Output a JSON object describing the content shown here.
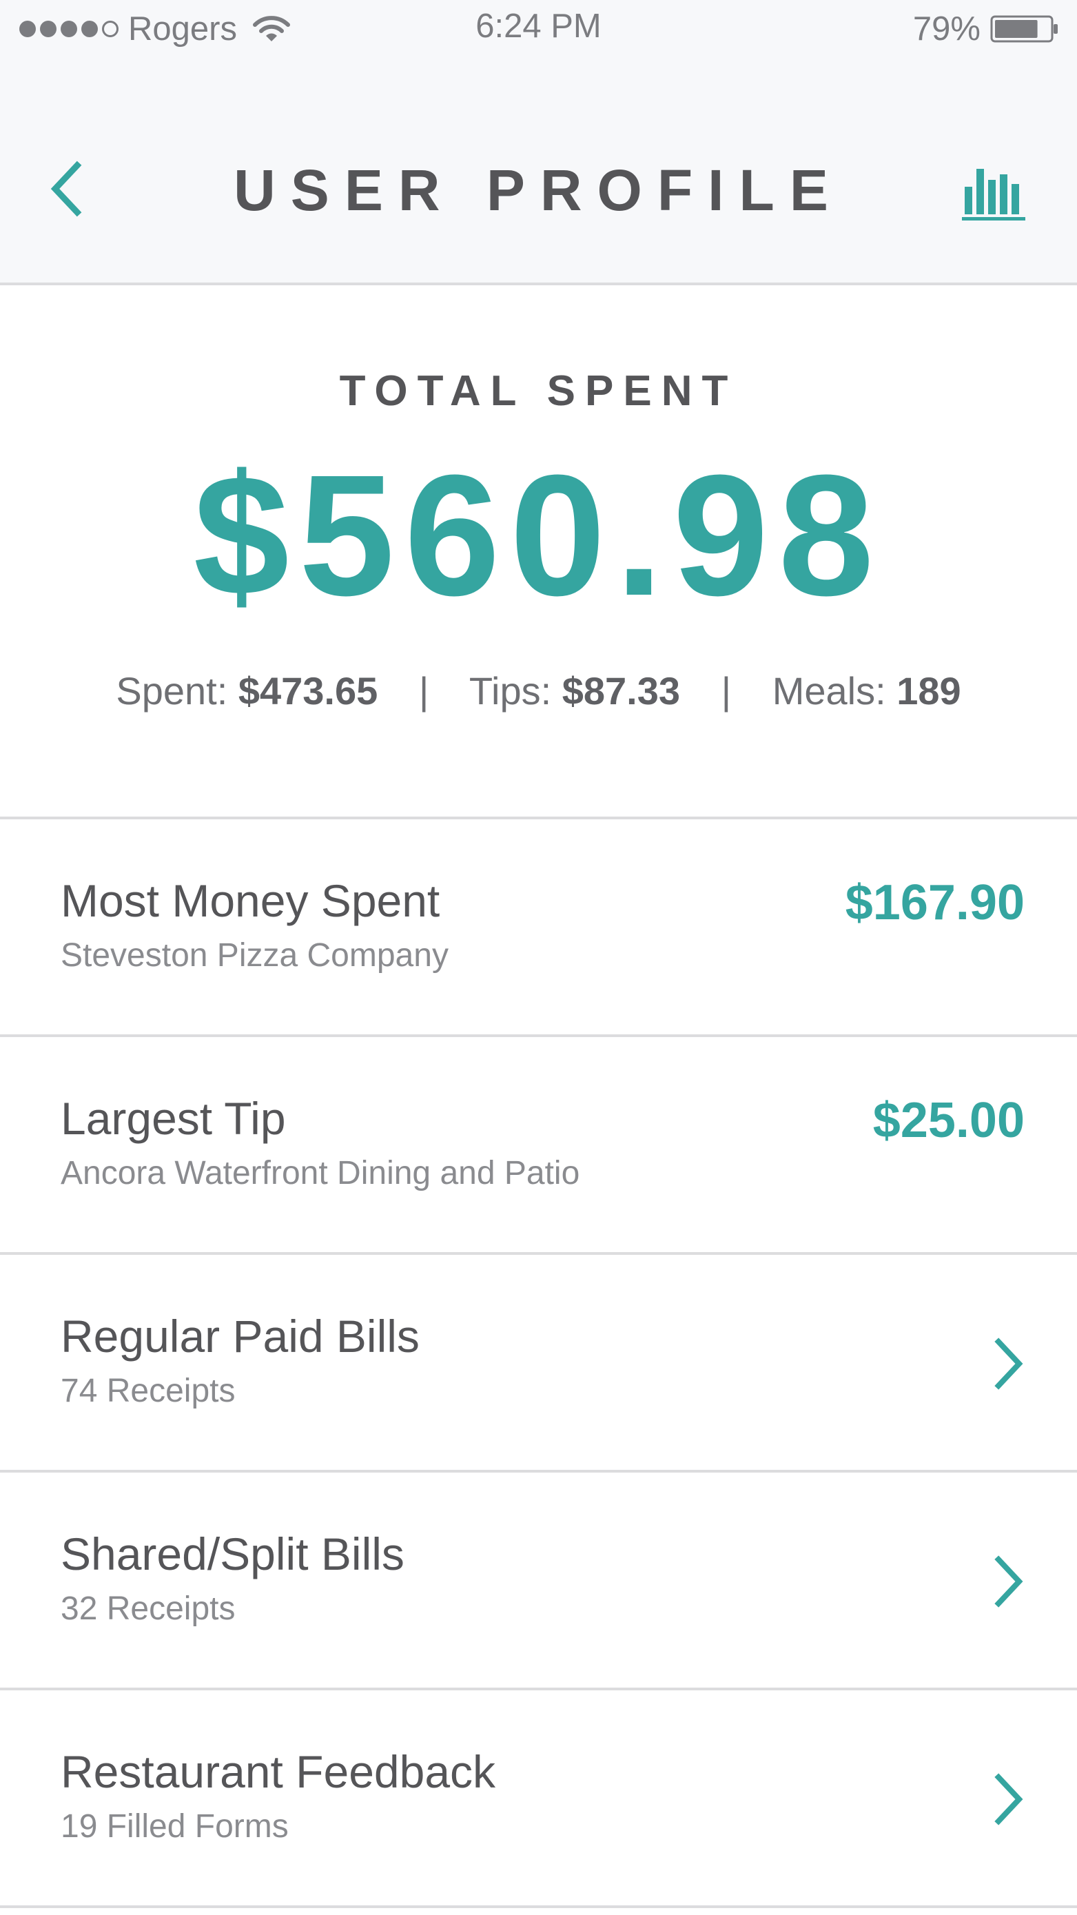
{
  "status_bar": {
    "carrier": "Rogers",
    "time": "6:24 PM",
    "battery": "79%",
    "battery_level": 0.79,
    "signal_bars_filled": 4,
    "signal_bars_total": 5
  },
  "header": {
    "title": "USER PROFILE",
    "back_icon": "chevron-left-icon",
    "stats_icon": "bar-chart-icon"
  },
  "summary": {
    "label": "TOTAL SPENT",
    "total": "$560.98",
    "spent_label": "Spent:",
    "spent_value": "$473.65",
    "tips_label": "Tips:",
    "tips_value": "$87.33",
    "meals_label": "Meals:",
    "meals_value": "189",
    "separator": "|"
  },
  "items": [
    {
      "title": "Most Money Spent",
      "subtitle": "Steveston Pizza Company",
      "value": "$167.90"
    },
    {
      "title": "Largest Tip",
      "subtitle": "Ancora Waterfront Dining and Patio",
      "value": "$25.00"
    },
    {
      "title": "Regular Paid Bills",
      "subtitle": "74 Receipts"
    },
    {
      "title": "Shared/Split Bills",
      "subtitle": "32 Receipts"
    },
    {
      "title": "Restaurant Feedback",
      "subtitle": "19 Filled Forms"
    }
  ],
  "colors": {
    "accent": "#35a5a0",
    "text": "#555558",
    "muted": "#8a8b8f",
    "divider": "#dcdcde",
    "nav_bg": "#f7f8fa"
  }
}
